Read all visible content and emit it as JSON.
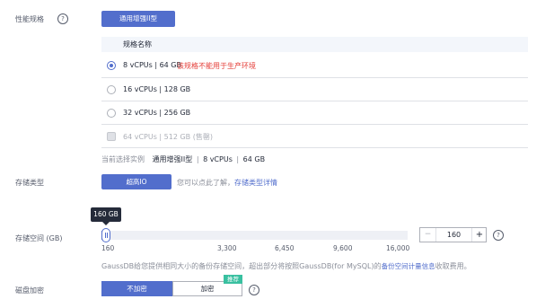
{
  "spec": {
    "label": "性能规格",
    "help": "?",
    "type_button": "通用增强II型",
    "table_header": "规格名称",
    "options": [
      {
        "label": "8 vCPUs | 64 GB",
        "note": "该规格不能用于生产环境",
        "state": "checked"
      },
      {
        "label": "16 vCPUs | 128 GB",
        "note": "",
        "state": "unchecked"
      },
      {
        "label": "32 vCPUs | 256 GB",
        "note": "",
        "state": "unchecked"
      },
      {
        "label": "64 vCPUs | 512 GB (售罄)",
        "note": "",
        "state": "disabled"
      }
    ],
    "current_prefix": "当前选择实例",
    "current_type": "通用增强II型",
    "current_cpu": "8 vCPUs",
    "current_mem": "64 GB"
  },
  "storage_type": {
    "label": "存储类型",
    "button": "超高IO",
    "hint": "您可以点此了解，",
    "link": "存储类型详情"
  },
  "storage_space": {
    "label": "存储空间 (GB)",
    "tooltip": "160 GB",
    "ticks": [
      "160",
      "3,300",
      "6,450",
      "9,600",
      "16,000"
    ],
    "min": 160,
    "max": 16000,
    "value": 160,
    "stepper_minus": "−",
    "stepper_value": "160",
    "stepper_plus": "+",
    "help": "?",
    "note_prefix": "GaussDB给您提供相同大小的备份存储空间，超出部分将按照GaussDB(for MySQL)的",
    "note_link": "备份空间计量信息",
    "note_suffix": "收取费用。"
  },
  "encryption": {
    "label": "磁盘加密",
    "off": "不加密",
    "on": "加密",
    "badge": "推荐",
    "help": "?"
  },
  "colors": {
    "accent": "#526ecc",
    "warning": "#e5403b",
    "badge": "#39c0a0"
  }
}
